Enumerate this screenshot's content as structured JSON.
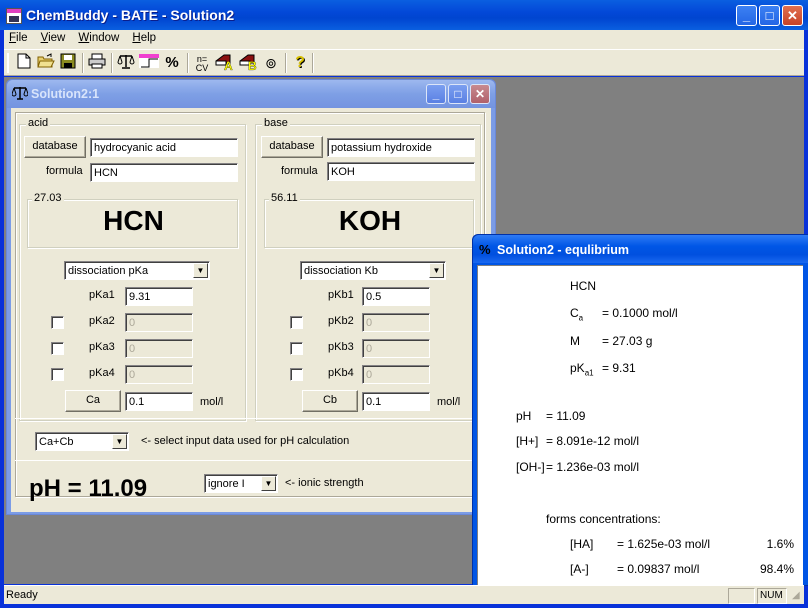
{
  "app": {
    "title": "ChemBuddy - BATE - Solution2",
    "icon": "bate-app-icon",
    "window_controls": {
      "minimize": "_",
      "maximize": "□",
      "close": "✕"
    }
  },
  "menu": [
    {
      "label": "File",
      "accel": "F"
    },
    {
      "label": "View",
      "accel": "V"
    },
    {
      "label": "Window",
      "accel": "W"
    },
    {
      "label": "Help",
      "accel": "H"
    }
  ],
  "toolbar": {
    "buttons": [
      {
        "name": "new-document-icon",
        "glyph": "🗋"
      },
      {
        "name": "open-folder-icon",
        "glyph": "📂"
      },
      {
        "name": "save-icon",
        "glyph": "💾"
      },
      {
        "name": "print-icon",
        "glyph": "🖶"
      },
      {
        "name": "balance-icon",
        "glyph": "⚖"
      },
      {
        "name": "titration-icon",
        "glyph": "▟"
      },
      {
        "name": "percent-icon",
        "glyph": "%"
      },
      {
        "name": "cv-icon",
        "glyph": "CV"
      },
      {
        "name": "acid-database-icon",
        "glyph": "A"
      },
      {
        "name": "base-database-icon",
        "glyph": "B"
      },
      {
        "name": "ionic-icon",
        "glyph": "⊚"
      },
      {
        "name": "help-icon",
        "glyph": "?"
      }
    ]
  },
  "solution_window": {
    "title": "Solution2:1",
    "icon": "balance-icon",
    "acid": {
      "group_label": "acid",
      "database_label": "database",
      "name": "hydrocyanic acid",
      "formula_label": "formula",
      "formula": "HCN",
      "molar_mass": "27.03",
      "display_formula": "HCN",
      "dissociation_select": "dissociation pKa",
      "pk": [
        {
          "label": "pKa1",
          "value": "9.31",
          "enabled": true,
          "checked": null
        },
        {
          "label": "pKa2",
          "value": "0",
          "enabled": false,
          "checked": false
        },
        {
          "label": "pKa3",
          "value": "0",
          "enabled": false,
          "checked": false
        },
        {
          "label": "pKa4",
          "value": "0",
          "enabled": false,
          "checked": false
        }
      ],
      "conc_button": "Ca",
      "conc_value": "0.1",
      "conc_unit": "mol/l"
    },
    "base": {
      "group_label": "base",
      "database_label": "database",
      "name": "potassium hydroxide",
      "formula_label": "formula",
      "formula": "KOH",
      "molar_mass": "56.11",
      "display_formula": "KOH",
      "dissociation_select": "dissociation Kb",
      "pk": [
        {
          "label": "pKb1",
          "value": "0.5",
          "enabled": true,
          "checked": null
        },
        {
          "label": "pKb2",
          "value": "0",
          "enabled": false,
          "checked": false
        },
        {
          "label": "pKb3",
          "value": "0",
          "enabled": false,
          "checked": false
        },
        {
          "label": "pKb4",
          "value": "0",
          "enabled": false,
          "checked": false
        }
      ],
      "conc_button": "Cb",
      "conc_value": "0.1",
      "conc_unit": "mol/l"
    },
    "input_select": "Ca+Cb",
    "input_hint": "<- select input data used for pH calculation",
    "ph_result": "pH = 11.09",
    "ionic_select": "ignore I",
    "ionic_hint": "<- ionic strength"
  },
  "equilibrium_window": {
    "title": "Solution2 - equlibrium",
    "icon": "percent-icon",
    "compound": "HCN",
    "ca_label": "C",
    "ca_sub": "a",
    "ca_value": "= 0.1000 mol/l",
    "m_label": "M",
    "m_value": "= 27.03 g",
    "pka_label": "pK",
    "pka_sub": "a1",
    "pka_value": "= 9.31",
    "ph_label": "pH",
    "ph_value": "= 11.09",
    "h_label": "[H+]",
    "h_value": "= 8.091e-12 mol/l",
    "oh_label": "[OH-]",
    "oh_value": "= 1.236e-03 mol/l",
    "forms_header": "forms concentrations:",
    "forms": [
      {
        "species": "[HA]",
        "conc": "= 1.625e-03 mol/l",
        "percent": "1.6%"
      },
      {
        "species": "[A-]",
        "conc": "= 0.09837 mol/l",
        "percent": "98.4%"
      }
    ]
  },
  "status": {
    "text": "Ready",
    "pane1": "",
    "pane2": "NUM"
  }
}
